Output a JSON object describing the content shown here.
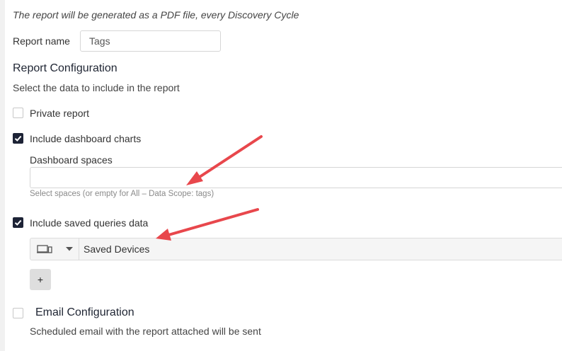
{
  "note": "The report will be generated as a PDF file, every Discovery Cycle",
  "report_name": {
    "label": "Report name",
    "value": "Tags"
  },
  "config": {
    "title": "Report Configuration",
    "subtitle": "Select the data to include in the report"
  },
  "private_report": {
    "label": "Private report",
    "checked": false
  },
  "dashboard_charts": {
    "label": "Include dashboard charts",
    "checked": true,
    "spaces_label": "Dashboard spaces",
    "spaces_value": "",
    "hint": "Select spaces (or empty for All – Data Scope: tags)"
  },
  "saved_queries": {
    "label": "Include saved queries data",
    "checked": true,
    "entity_icon": "devices-icon",
    "query_value": "Saved Devices",
    "add_label": "+"
  },
  "email": {
    "title": "Email Configuration",
    "checked": false,
    "subtitle": "Scheduled email with the report attached will be sent"
  },
  "colors": {
    "checkbox_checked": "#1d2336",
    "annotation_arrow": "#e8474c"
  }
}
